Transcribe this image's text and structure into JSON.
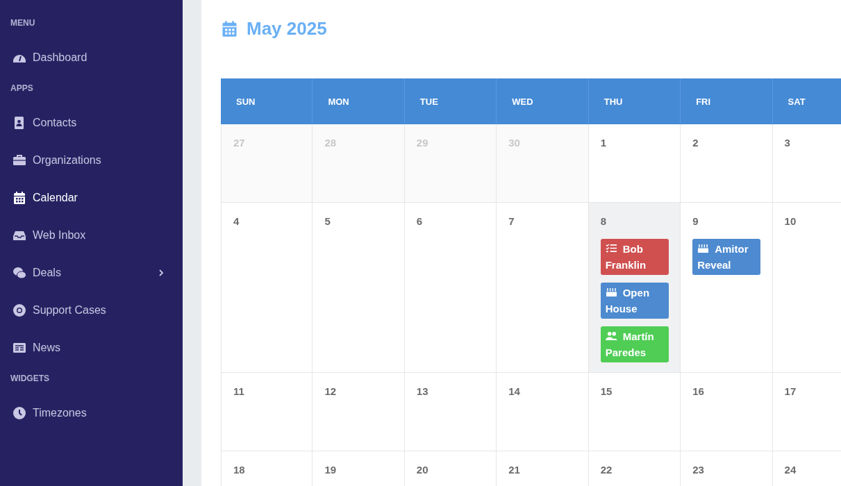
{
  "sidebar": {
    "sections": [
      {
        "heading": "MENU",
        "items": [
          {
            "kind": "dashboard",
            "label": "Dashboard",
            "selected": false,
            "submenu": false
          }
        ]
      },
      {
        "heading": "APPS",
        "items": [
          {
            "kind": "contacts",
            "label": "Contacts",
            "selected": false,
            "submenu": false
          },
          {
            "kind": "briefcase",
            "label": "Organizations",
            "selected": false,
            "submenu": false
          },
          {
            "kind": "calendar",
            "label": "Calendar",
            "selected": true,
            "submenu": false
          },
          {
            "kind": "inbox",
            "label": "Web Inbox",
            "selected": false,
            "submenu": false
          },
          {
            "kind": "deals",
            "label": "Deals",
            "selected": false,
            "submenu": true
          },
          {
            "kind": "support",
            "label": "Support Cases",
            "selected": false,
            "submenu": false
          },
          {
            "kind": "news",
            "label": "News",
            "selected": false,
            "submenu": false
          }
        ]
      },
      {
        "heading": "WIDGETS",
        "items": [
          {
            "kind": "clock",
            "label": "Timezones",
            "selected": false,
            "submenu": false
          }
        ]
      }
    ]
  },
  "calendar": {
    "title": "May 2025",
    "weekdays": [
      "SUN",
      "MON",
      "TUE",
      "WED",
      "THU",
      "FRI",
      "SAT"
    ],
    "weeks": [
      [
        {
          "day": "27",
          "other_month": true,
          "today": false
        },
        {
          "day": "28",
          "other_month": true,
          "today": false
        },
        {
          "day": "29",
          "other_month": true,
          "today": false
        },
        {
          "day": "30",
          "other_month": true,
          "today": false
        },
        {
          "day": "1",
          "other_month": false,
          "today": false
        },
        {
          "day": "2",
          "other_month": false,
          "today": false
        },
        {
          "day": "3",
          "other_month": false,
          "today": false
        }
      ],
      [
        {
          "day": "4",
          "other_month": false,
          "today": false
        },
        {
          "day": "5",
          "other_month": false,
          "today": false
        },
        {
          "day": "6",
          "other_month": false,
          "today": false
        },
        {
          "day": "7",
          "other_month": false,
          "today": false
        },
        {
          "day": "8",
          "other_month": false,
          "today": true,
          "events": [
            {
              "kind": "task",
              "title": "Bob Franklin",
              "color": "#d05050"
            },
            {
              "kind": "birthday",
              "title": "Open House",
              "color": "#4d8acf"
            },
            {
              "kind": "meeting",
              "title": "Martín Paredes",
              "color": "#4fcd55"
            }
          ]
        },
        {
          "day": "9",
          "other_month": false,
          "today": false,
          "events": [
            {
              "kind": "birthday",
              "title": "Amitor Reveal",
              "color": "#4d8acf"
            }
          ]
        },
        {
          "day": "10",
          "other_month": false,
          "today": false
        }
      ],
      [
        {
          "day": "11",
          "other_month": false,
          "today": false
        },
        {
          "day": "12",
          "other_month": false,
          "today": false
        },
        {
          "day": "13",
          "other_month": false,
          "today": false
        },
        {
          "day": "14",
          "other_month": false,
          "today": false
        },
        {
          "day": "15",
          "other_month": false,
          "today": false
        },
        {
          "day": "16",
          "other_month": false,
          "today": false
        },
        {
          "day": "17",
          "other_month": false,
          "today": false
        }
      ],
      [
        {
          "day": "18",
          "other_month": false,
          "today": false
        },
        {
          "day": "19",
          "other_month": false,
          "today": false
        },
        {
          "day": "20",
          "other_month": false,
          "today": false
        },
        {
          "day": "21",
          "other_month": false,
          "today": false
        },
        {
          "day": "22",
          "other_month": false,
          "today": false
        },
        {
          "day": "23",
          "other_month": false,
          "today": false
        },
        {
          "day": "24",
          "other_month": false,
          "today": false
        }
      ]
    ]
  }
}
